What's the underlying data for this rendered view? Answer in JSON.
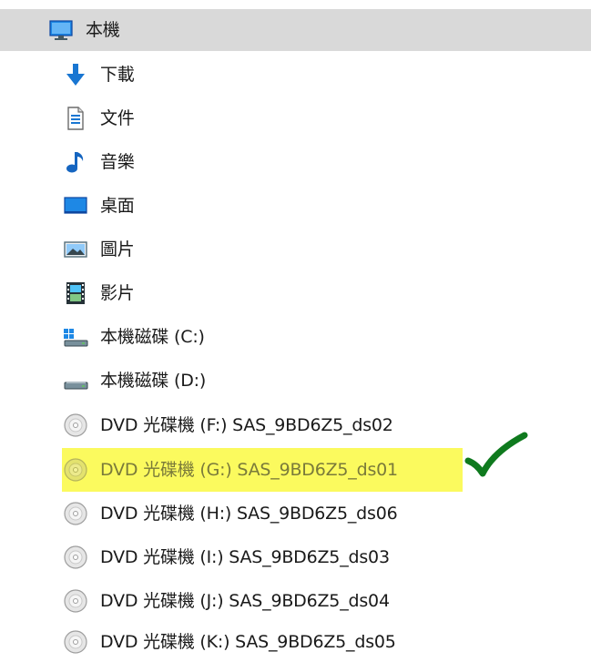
{
  "nav": {
    "root": {
      "label": "本機",
      "icon": "computer-icon"
    },
    "items": [
      {
        "label": "下載",
        "icon": "download-arrow-icon"
      },
      {
        "label": "文件",
        "icon": "document-icon"
      },
      {
        "label": "音樂",
        "icon": "music-note-icon"
      },
      {
        "label": "桌面",
        "icon": "desktop-icon"
      },
      {
        "label": "圖片",
        "icon": "pictures-icon"
      },
      {
        "label": "影片",
        "icon": "videos-icon"
      },
      {
        "label": "本機磁碟 (C:)",
        "icon": "windows-drive-icon"
      },
      {
        "label": "本機磁碟 (D:)",
        "icon": "drive-icon"
      },
      {
        "label": "DVD 光碟機 (F:) SAS_9BD6Z5_ds02",
        "icon": "dvd-icon"
      },
      {
        "label": "DVD 光碟機 (G:) SAS_9BD6Z5_ds01",
        "icon": "dvd-icon",
        "highlighted": true,
        "annotated_check": true
      },
      {
        "label": "DVD 光碟機 (H:) SAS_9BD6Z5_ds06",
        "icon": "dvd-icon"
      },
      {
        "label": "DVD 光碟機 (I:) SAS_9BD6Z5_ds03",
        "icon": "dvd-icon"
      },
      {
        "label": "DVD 光碟機 (J:) SAS_9BD6Z5_ds04",
        "icon": "dvd-icon"
      },
      {
        "label": "DVD 光碟機 (K:) SAS_9BD6Z5_ds05",
        "icon": "dvd-icon"
      }
    ]
  },
  "colors": {
    "root_bg": "#d9d9d9",
    "highlight": "#fbfa5e",
    "checkmark": "#0f7a1e",
    "accent_blue": "#1976d2"
  }
}
